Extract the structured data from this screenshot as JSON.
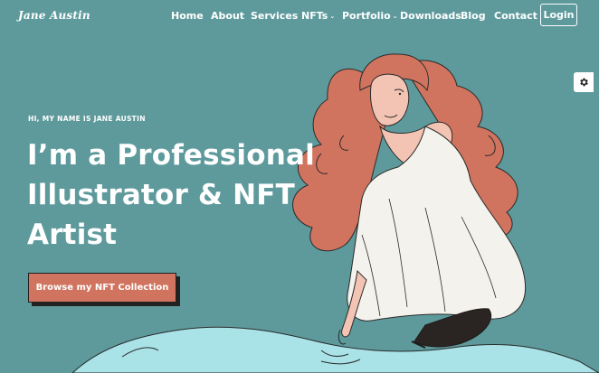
{
  "header": {
    "logo": "Jane Austin",
    "nav": [
      {
        "label": "Home",
        "dropdown": false
      },
      {
        "label": "About",
        "dropdown": false
      },
      {
        "label": "Services",
        "dropdown": false
      },
      {
        "label": "NFTs",
        "dropdown": true
      },
      {
        "label": "Portfolio",
        "dropdown": true
      },
      {
        "label": "Downloads",
        "dropdown": false
      },
      {
        "label": "Blog",
        "dropdown": false
      },
      {
        "label": "Contact",
        "dropdown": false
      }
    ],
    "login_label": "Login"
  },
  "hero": {
    "kicker": "HI, MY NAME IS JANE AUSTIN",
    "headline_lines": [
      "I’m a Professional",
      "Illustrator & NFT",
      "Artist"
    ],
    "cta_label": "Browse my NFT Collection"
  },
  "settings_icon": "gear-icon",
  "colors": {
    "background": "#5e9a9c",
    "cta": "#d0745f",
    "hair": "#d0745f",
    "dress": "#f4f2ec",
    "water": "#a9e3e8"
  }
}
